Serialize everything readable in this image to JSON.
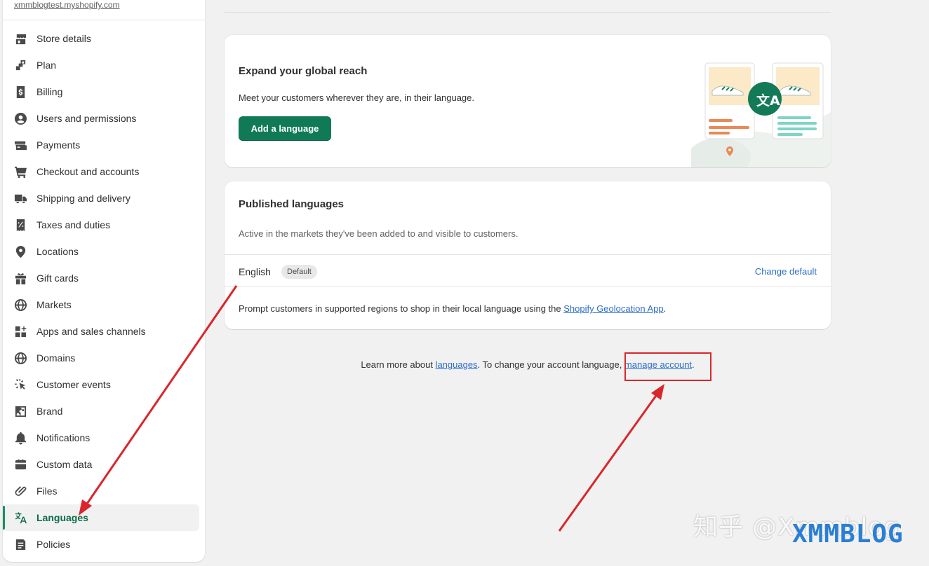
{
  "sidebar": {
    "store_url": "xmmblogtest.myshopify.com",
    "items": [
      {
        "label": "Store details",
        "icon": "store-icon"
      },
      {
        "label": "Plan",
        "icon": "plan-icon"
      },
      {
        "label": "Billing",
        "icon": "billing-icon"
      },
      {
        "label": "Users and permissions",
        "icon": "user-icon"
      },
      {
        "label": "Payments",
        "icon": "payments-icon"
      },
      {
        "label": "Checkout and accounts",
        "icon": "cart-icon"
      },
      {
        "label": "Shipping and delivery",
        "icon": "truck-icon"
      },
      {
        "label": "Taxes and duties",
        "icon": "receipt-icon"
      },
      {
        "label": "Locations",
        "icon": "location-pin-icon"
      },
      {
        "label": "Gift cards",
        "icon": "gift-icon"
      },
      {
        "label": "Markets",
        "icon": "globe-icon"
      },
      {
        "label": "Apps and sales channels",
        "icon": "apps-icon"
      },
      {
        "label": "Domains",
        "icon": "globe-icon"
      },
      {
        "label": "Customer events",
        "icon": "cursor-click-icon"
      },
      {
        "label": "Brand",
        "icon": "brand-icon"
      },
      {
        "label": "Notifications",
        "icon": "bell-icon"
      },
      {
        "label": "Custom data",
        "icon": "database-icon"
      },
      {
        "label": "Files",
        "icon": "paperclip-icon"
      },
      {
        "label": "Languages",
        "icon": "translate-icon",
        "active": true
      },
      {
        "label": "Policies",
        "icon": "document-icon"
      }
    ]
  },
  "reach_card": {
    "title": "Expand your global reach",
    "description": "Meet your customers wherever they are, in their language.",
    "button_label": "Add a language",
    "illustration_icon": "translate-icon"
  },
  "published_card": {
    "title": "Published languages",
    "description": "Active in the markets they've been added to and visible to customers.",
    "language": "English",
    "badge": "Default",
    "change_default": "Change default",
    "prompt_prefix": "Prompt customers in supported regions to shop in their local language using the ",
    "prompt_link": "Shopify Geolocation App",
    "prompt_suffix": "."
  },
  "footer": {
    "prefix": "Learn more about ",
    "languages_link": "languages",
    "middle": ". To change your account language, ",
    "manage_link": "manage account",
    "suffix": "."
  },
  "watermark": {
    "zhihu": "知乎 @Xmmblog",
    "logo": "XMMBLOG"
  },
  "colors": {
    "primary": "#107a57",
    "link": "#2c6ecb",
    "annotation": "#d9262c",
    "active_nav": "#0b6b47"
  }
}
